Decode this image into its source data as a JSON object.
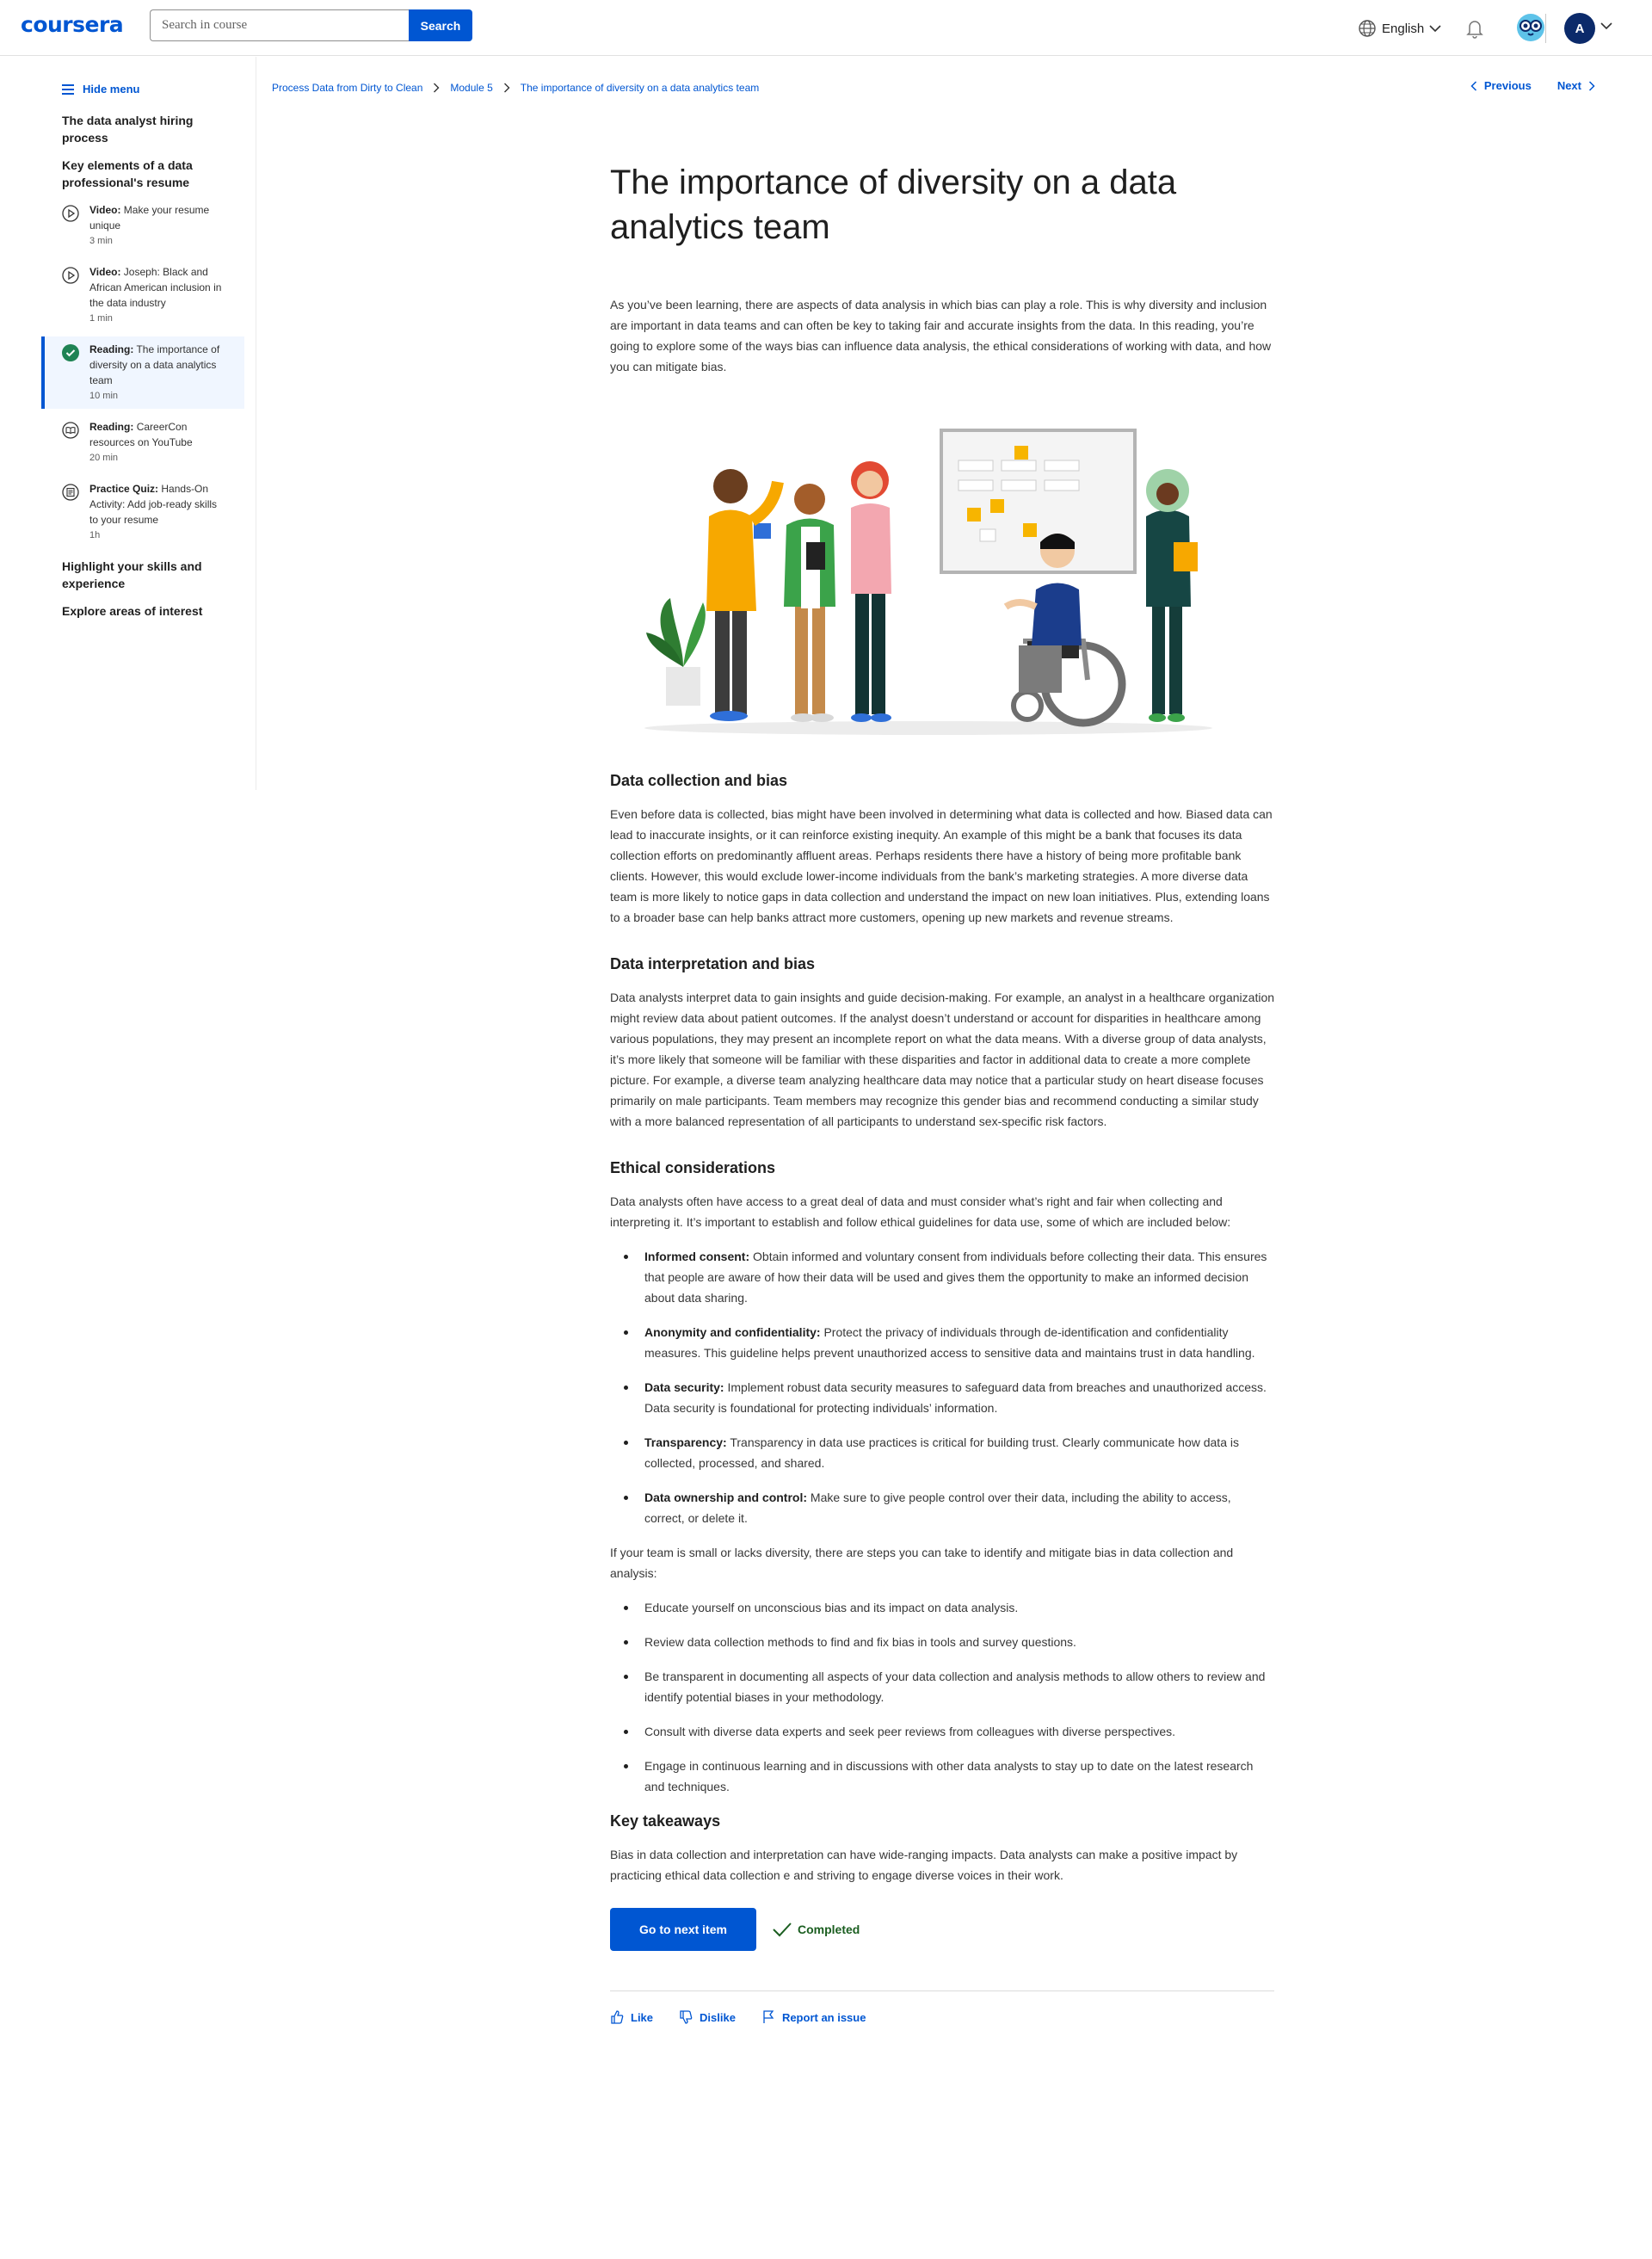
{
  "header": {
    "logo": "coursera",
    "search_placeholder": "Search in course",
    "search_button": "Search",
    "language": "English",
    "avatar_initial": "A"
  },
  "sidebar": {
    "hide_menu": "Hide menu",
    "sections": [
      "The data analyst hiring process",
      "Key elements of a data professional's resume",
      "Highlight your skills and experience",
      "Explore areas of interest"
    ],
    "items": [
      {
        "type": "Video:",
        "title": "Make your resume unique",
        "duration": "3 min",
        "icon": "play-icon"
      },
      {
        "type": "Video:",
        "title": "Joseph: Black and African American inclusion in the data industry",
        "duration": "1 min",
        "icon": "play-icon"
      },
      {
        "type": "Reading:",
        "title": "The importance of diversity on a data analytics team",
        "duration": "10 min",
        "icon": "check-circle-icon"
      },
      {
        "type": "Reading:",
        "title": "CareerCon resources on YouTube",
        "duration": "20 min",
        "icon": "book-icon"
      },
      {
        "type": "Practice Quiz:",
        "title": "Hands-On Activity: Add job-ready skills to your resume",
        "duration": "1h",
        "icon": "quiz-icon"
      }
    ]
  },
  "breadcrumb": [
    "Process Data from Dirty to Clean",
    "Module 5",
    "The importance of diversity on a data analytics team"
  ],
  "nav": {
    "previous": "Previous",
    "next": "Next"
  },
  "article": {
    "title": "The importance of diversity on a data analytics team",
    "intro": "As you’ve been learning, there are aspects of data analysis in which bias can play a role. This is why diversity and inclusion are important in data teams and can often be key to taking fair and accurate insights from the data. In this reading, you’re going to explore some of the ways bias can influence data analysis, the ethical considerations of working with data, and how you can mitigate bias.",
    "s1_title": "Data collection and bias",
    "s1_body": "Even before data is collected, bias might have been involved in determining what data is collected and how. Biased data can lead to inaccurate insights, or it can reinforce existing inequity. An example of this might be a bank that focuses its data collection efforts on predominantly affluent areas. Perhaps residents there have a history of being more profitable bank clients. However, this would exclude lower-income individuals from the bank’s  marketing strategies. A more diverse data team is more likely to notice gaps in data collection and understand the impact on new loan initiatives. Plus, extending loans to a broader base can help banks attract more customers, opening up new markets and revenue streams.",
    "s2_title": "Data interpretation and bias",
    "s2_body": "Data analysts interpret data to gain insights and guide decision-making. For example, an analyst in a healthcare organization might review data about patient outcomes. If the analyst doesn’t understand or account for disparities in healthcare among various populations, they may present an incomplete report on what the data means. With a diverse group of data analysts, it’s more likely that someone will be familiar with these disparities and factor in additional data to create a more complete picture. For example, a diverse team analyzing healthcare data may notice that a particular study on heart disease focuses primarily on male participants. Team members may recognize this gender bias and recommend conducting a similar study with a more balanced representation of all participants to understand sex-specific risk factors.",
    "s3_title": "Ethical considerations",
    "s3_body": "Data analysts often have access to a great deal of data and must consider what’s right and fair when collecting and interpreting it. It’s important to establish and follow ethical guidelines for data use, some of which are included below:",
    "ethics": [
      {
        "term": "Informed consent:",
        "text": " Obtain informed and voluntary consent from individuals before collecting their data. This ensures that people are aware of how their data will be used and gives them the opportunity to make an informed decision about data sharing."
      },
      {
        "term": "Anonymity and confidentiality:",
        "text": " Protect the privacy of individuals through de-identification and confidentiality measures. This guideline helps prevent unauthorized access to sensitive data and maintains trust in data handling."
      },
      {
        "term": "Data security:",
        "text": " Implement robust data security measures to safeguard data from breaches and unauthorized access. Data security is foundational for protecting individuals’ information."
      },
      {
        "term": "Transparency:",
        "text": " Transparency in data use practices is critical for building trust. Clearly communicate how data is collected, processed, and shared."
      },
      {
        "term": "Data ownership and control:",
        "text": "  Make sure to give people control over their data, including the ability to access, correct, or delete it."
      }
    ],
    "s3_body2": "If your team is small or lacks diversity, there are steps you can take to identify and mitigate bias in data collection and analysis:",
    "steps": [
      "Educate yourself on unconscious bias and its impact on data analysis.",
      "Review data collection methods to find and fix bias in tools and survey questions.",
      "Be transparent in documenting all aspects of your data collection and analysis methods to allow others to review and identify potential biases in your methodology.",
      "Consult with diverse data experts and seek peer reviews from colleagues with diverse perspectives.",
      "Engage in continuous learning and in discussions with other data analysts to stay up to date on the latest research and techniques."
    ],
    "s4_title": "Key takeaways",
    "s4_body": "Bias in data collection and interpretation can have wide-ranging impacts. Data analysts can make a positive impact by practicing ethical data collection e and striving to engage diverse voices in their work."
  },
  "actions": {
    "next_item": "Go to next item",
    "completed": "Completed"
  },
  "feedback": {
    "like": "Like",
    "dislike": "Dislike",
    "report": "Report an issue"
  },
  "colors": {
    "brand": "#0056d2",
    "completed": "#1b5e20",
    "active_bg": "#f0f6ff"
  }
}
